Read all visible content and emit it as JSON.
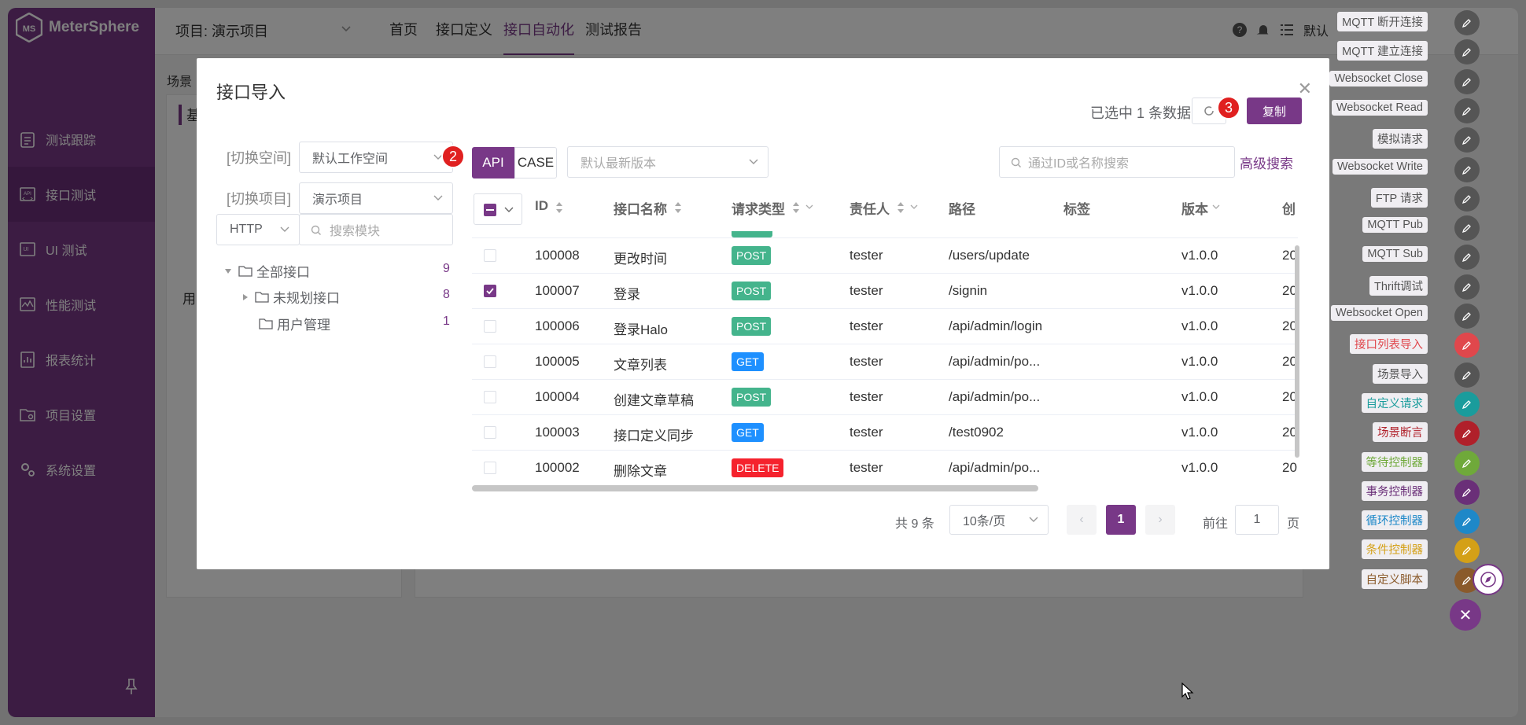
{
  "app": {
    "name": "MeterSphere"
  },
  "sidebar": {
    "items": [
      {
        "label": "测试跟踪",
        "icon": "clipboard-icon"
      },
      {
        "label": "接口测试",
        "icon": "api-icon",
        "active": true
      },
      {
        "label": "UI 测试",
        "icon": "ui-icon"
      },
      {
        "label": "性能测试",
        "icon": "performance-icon"
      },
      {
        "label": "报表统计",
        "icon": "report-icon"
      },
      {
        "label": "项目设置",
        "icon": "folder-settings-icon"
      },
      {
        "label": "系统设置",
        "icon": "gears-icon"
      }
    ]
  },
  "topbar": {
    "project": "项目: 演示项目",
    "tabs": [
      "首页",
      "接口定义",
      "接口自动化",
      "测试报告"
    ],
    "active_tab": "接口自动化",
    "workspace_truncated": "默认"
  },
  "background": {
    "breadcrumb": "场景",
    "block_text": "基",
    "side_text": "用"
  },
  "float_menu": {
    "items": [
      {
        "label": "MQTT 断开连接",
        "color": "#555"
      },
      {
        "label": "MQTT 建立连接",
        "color": "#555"
      },
      {
        "label": "Websocket Close",
        "color": "#555"
      },
      {
        "label": "Websocket Read",
        "color": "#555"
      },
      {
        "label": "模拟请求",
        "color": "#555"
      },
      {
        "label": "Websocket Write",
        "color": "#555"
      },
      {
        "label": "FTP 请求",
        "color": "#555"
      },
      {
        "label": "MQTT Pub",
        "color": "#555"
      },
      {
        "label": "MQTT Sub",
        "color": "#555"
      },
      {
        "label": "Thrift调试",
        "color": "#555"
      },
      {
        "label": "Websocket Open",
        "color": "#555"
      },
      {
        "label": "接口列表导入",
        "color": "#e0474c"
      },
      {
        "label": "场景导入",
        "color": "#555"
      },
      {
        "label": "自定义请求",
        "color": "#1a9c9c"
      },
      {
        "label": "场景断言",
        "color": "#b0202a"
      },
      {
        "label": "等待控制器",
        "color": "#6fa93a"
      },
      {
        "label": "事务控制器",
        "color": "#6a2f78"
      },
      {
        "label": "循环控制器",
        "color": "#1e88c8"
      },
      {
        "label": "条件控制器",
        "color": "#d4a017"
      },
      {
        "label": "自定义脚本",
        "color": "#8a5a2b"
      }
    ]
  },
  "dialog": {
    "title": "接口导入",
    "selected_info": "已选中 1 条数据",
    "copy_label": "复制",
    "badge_2": "2",
    "badge_3": "3",
    "switch_space_label": "[切换空间]",
    "space_value": "默认工作空间",
    "switch_project_label": "[切换项目]",
    "project_value": "演示项目",
    "protocol": "HTTP",
    "module_search_placeholder": "搜索模块",
    "tree": [
      {
        "label": "全部接口",
        "count": "9"
      },
      {
        "label": "未规划接口",
        "count": "8"
      },
      {
        "label": "用户管理",
        "count": "1"
      }
    ],
    "api_label": "API",
    "case_label": "CASE",
    "version_placeholder": "默认最新版本",
    "search_placeholder": "通过ID或名称搜索",
    "advanced_search": "高级搜索",
    "columns": [
      "ID",
      "接口名称",
      "请求类型",
      "责任人",
      "路径",
      "标签",
      "版本",
      "创"
    ],
    "rows": [
      {
        "id": "100008",
        "name": "更改时间",
        "method": "POST",
        "owner": "tester",
        "path": "/users/update",
        "version": "v1.0.0",
        "created": "20",
        "checked": false
      },
      {
        "id": "100007",
        "name": "登录",
        "method": "POST",
        "owner": "tester",
        "path": "/signin",
        "version": "v1.0.0",
        "created": "20",
        "checked": true
      },
      {
        "id": "100006",
        "name": "登录Halo",
        "method": "POST",
        "owner": "tester",
        "path": "/api/admin/login",
        "version": "v1.0.0",
        "created": "20",
        "checked": false
      },
      {
        "id": "100005",
        "name": "文章列表",
        "method": "GET",
        "owner": "tester",
        "path": "/api/admin/po...",
        "version": "v1.0.0",
        "created": "20",
        "checked": false
      },
      {
        "id": "100004",
        "name": "创建文章草稿",
        "method": "POST",
        "owner": "tester",
        "path": "/api/admin/po...",
        "version": "v1.0.0",
        "created": "20",
        "checked": false
      },
      {
        "id": "100003",
        "name": "接口定义同步",
        "method": "GET",
        "owner": "tester",
        "path": "/test0902",
        "version": "v1.0.0",
        "created": "20",
        "checked": false
      },
      {
        "id": "100002",
        "name": "删除文章",
        "method": "DELETE",
        "owner": "tester",
        "path": "/api/admin/po...",
        "version": "v1.0.0",
        "created": "20",
        "checked": false
      }
    ],
    "pagination": {
      "total": "共 9 条",
      "page_size": "10条/页",
      "current": "1",
      "goto_prefix": "前往",
      "goto_value": "1",
      "goto_suffix": "页"
    }
  },
  "colors": {
    "brand": "#783887",
    "post": "#44b48c",
    "get": "#1e90ff",
    "delete": "#f5222d"
  }
}
